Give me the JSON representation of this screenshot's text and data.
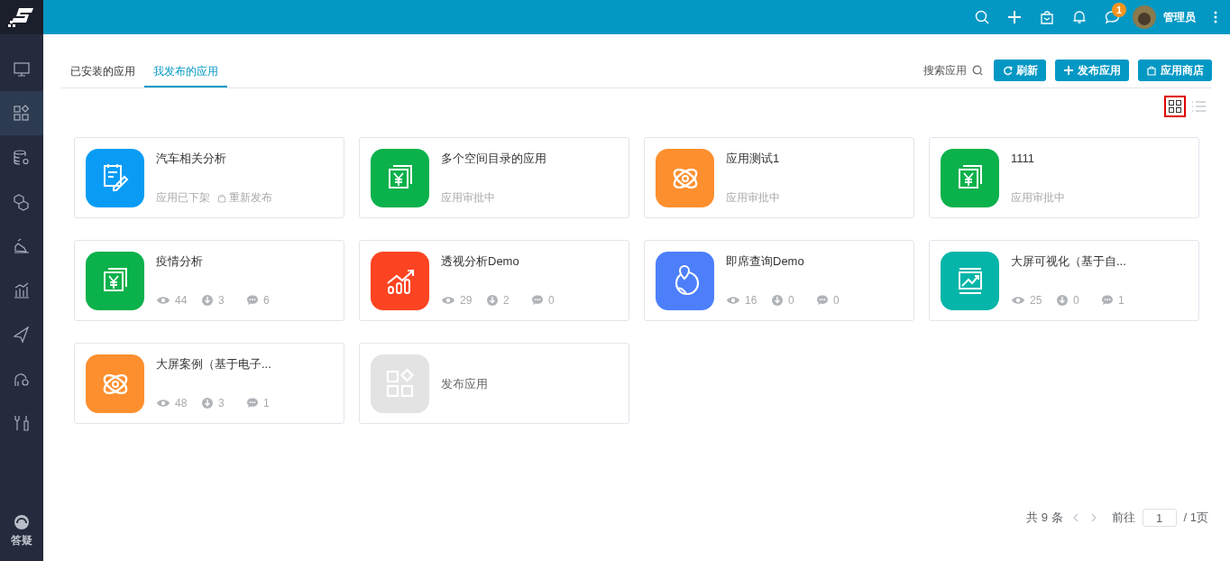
{
  "sidebar": {
    "items": [
      {
        "kind": "monitor",
        "selected": false
      },
      {
        "kind": "apps",
        "selected": true
      },
      {
        "kind": "database",
        "selected": false
      },
      {
        "kind": "cubes",
        "selected": false
      },
      {
        "kind": "tools",
        "selected": false
      },
      {
        "kind": "chart",
        "selected": false
      },
      {
        "kind": "plane",
        "selected": false
      },
      {
        "kind": "flow",
        "selected": false
      },
      {
        "kind": "wrench",
        "selected": false
      }
    ],
    "help": {
      "label": "答疑"
    }
  },
  "header": {
    "notification_count": "1",
    "user": "管理员"
  },
  "tabs": [
    {
      "label": "已安装的应用",
      "selected": false
    },
    {
      "label": "我发布的应用",
      "selected": true
    }
  ],
  "toolbar": {
    "search": "搜索应用",
    "buttons": [
      {
        "kind": "refresh",
        "label": "刷新"
      },
      {
        "kind": "plus",
        "label": "发布应用"
      },
      {
        "kind": "bag",
        "label": "应用商店"
      }
    ]
  },
  "view_toggle": [
    {
      "kind": "grid",
      "selected": true
    },
    {
      "kind": "list",
      "selected": false
    }
  ],
  "apps": [
    {
      "kind": "status",
      "color": "#0a9cf5",
      "title": "汽车相关分析",
      "status": "应用已下架",
      "action": "重新发布"
    },
    {
      "kind": "status",
      "color": "#0bb14b",
      "title": "多个空间目录的应用",
      "status": "应用审批中"
    },
    {
      "kind": "status",
      "color": "#fd8f2e",
      "title": "应用测试1",
      "status": "应用审批中"
    },
    {
      "kind": "status",
      "color": "#0bb14b",
      "title": "1111",
      "status": "应用审批中"
    },
    {
      "kind": "stats",
      "color": "#0bb14b",
      "title": "疫情分析",
      "views": "44",
      "downloads": "3",
      "comments": "6"
    },
    {
      "kind": "stats",
      "color": "#fd4422",
      "title": "透视分析Demo",
      "views": "29",
      "downloads": "2",
      "comments": "0"
    },
    {
      "kind": "stats",
      "color": "#4d7ffb",
      "title": "即席查询Demo",
      "views": "16",
      "downloads": "0",
      "comments": "0"
    },
    {
      "kind": "stats",
      "color": "#06b5a9",
      "title": "大屏可视化（基于自...",
      "views": "25",
      "downloads": "0",
      "comments": "1"
    },
    {
      "kind": "stats",
      "color": "#fd8f2e",
      "title": "大屏案例（基于电子...",
      "views": "48",
      "downloads": "3",
      "comments": "1"
    },
    {
      "kind": "add",
      "color": "#e3e3e3",
      "title": "发布应用"
    }
  ],
  "pagination": {
    "total": "共 9 条",
    "goto": "前往",
    "page": "1",
    "pages": "/ 1页"
  }
}
